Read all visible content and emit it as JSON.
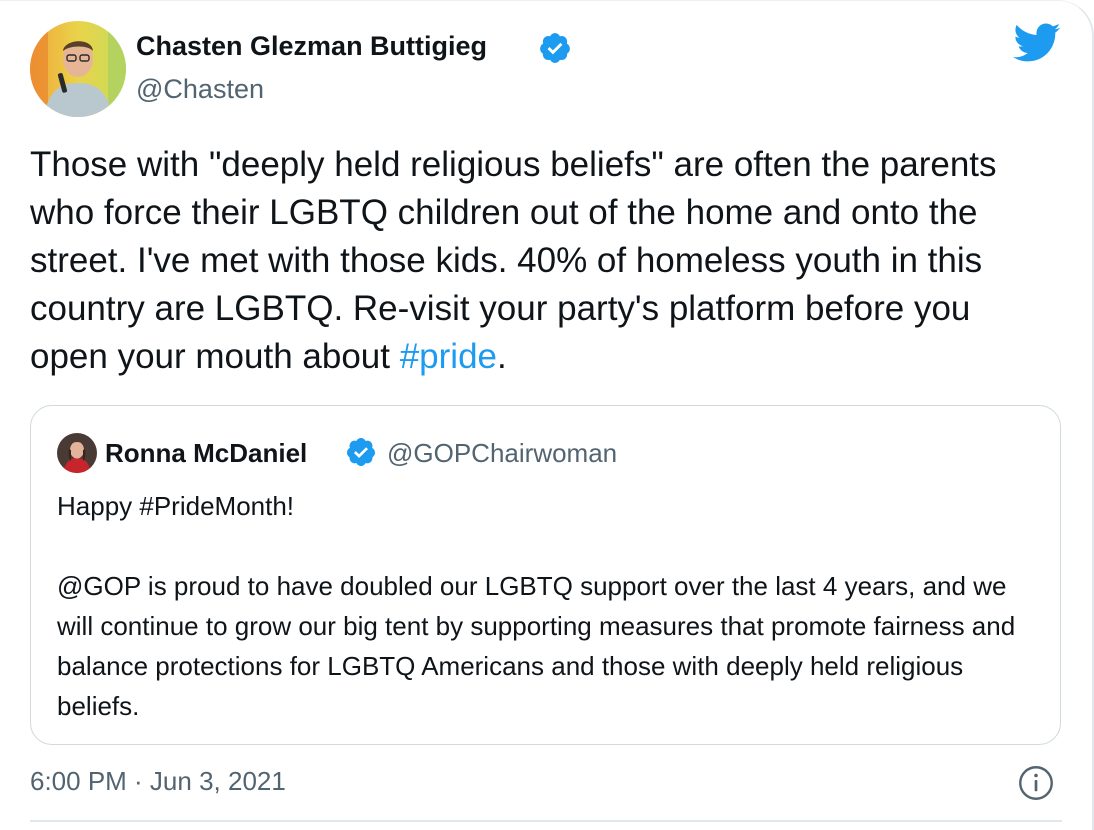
{
  "author": {
    "name": "Chasten Glezman Buttigieg",
    "handle": "@Chasten",
    "verified": true
  },
  "tweet": {
    "text": "Those with \"deeply held religious beliefs\" are often the parents who force their LGBTQ children out of the home and onto the street. I've met with those kids. 40% of homeless youth in this country are LGBTQ. Re-visit your party's platform before you open your mouth about ",
    "hashtag": "#pride",
    "end": "."
  },
  "quoted_tweet": {
    "name": "Ronna McDaniel",
    "handle": "@GOPChairwoman",
    "verified": true,
    "text": "Happy #PrideMonth!\n\n@GOP is proud to have doubled our LGBTQ support over the last 4 years, and we will continue to grow our big tent by supporting measures that promote fairness and balance protections for LGBTQ Americans and those with deeply held religious beliefs."
  },
  "timestamp": "6:00 PM · Jun 3, 2021",
  "icons": {
    "verified": "verified-badge-icon",
    "brand": "twitter-bird-icon",
    "info": "info-icon"
  },
  "colors": {
    "accent": "#1d9bf0",
    "text": "#0f1419",
    "muted": "#536471",
    "border": "#cfd9de"
  }
}
